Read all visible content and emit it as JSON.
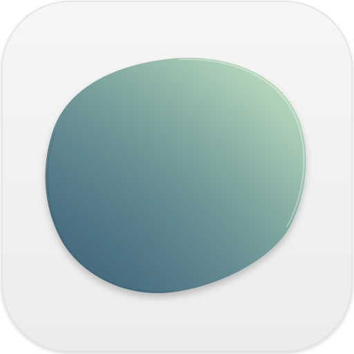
{
  "icon": {
    "name": "pebble-app-icon",
    "tile_color_top": "#f6f6f6",
    "tile_color_bottom": "#ececec",
    "tile_border_color": "#e2e2e2",
    "shape_color_light": "#b8d8bd",
    "shape_color_mid": "#7aa29e",
    "shape_color_dark": "#4a6f82"
  }
}
